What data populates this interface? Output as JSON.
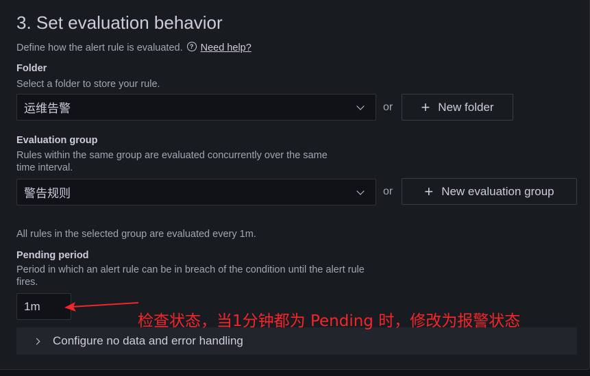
{
  "section": {
    "title": "3. Set evaluation behavior",
    "description": "Define how the alert rule is evaluated.",
    "help_link": "Need help?",
    "help_icon": "help-circle-icon"
  },
  "folder": {
    "label": "Folder",
    "description": "Select a folder to store your rule.",
    "selected": "运维告警",
    "or_text": "or",
    "new_button": "New folder"
  },
  "evaluation_group": {
    "label": "Evaluation group",
    "description_line1": "Rules within the same group are evaluated concurrently over the same",
    "description_line2": "time interval.",
    "selected": "警告规则",
    "or_text": "or",
    "new_button": "New evaluation group",
    "interval_note": "All rules in the selected group are evaluated every 1m."
  },
  "pending_period": {
    "label": "Pending period",
    "description_line1": "Period in which an alert rule can be in breach of the condition until the alert rule",
    "description_line2": "fires.",
    "value": "1m"
  },
  "annotation": {
    "text": "检查状态，当1分钟都为 Pending 时，修改为报警状态",
    "color": "#f2262b"
  },
  "no_data_section": {
    "label": "Configure no data and error handling"
  }
}
